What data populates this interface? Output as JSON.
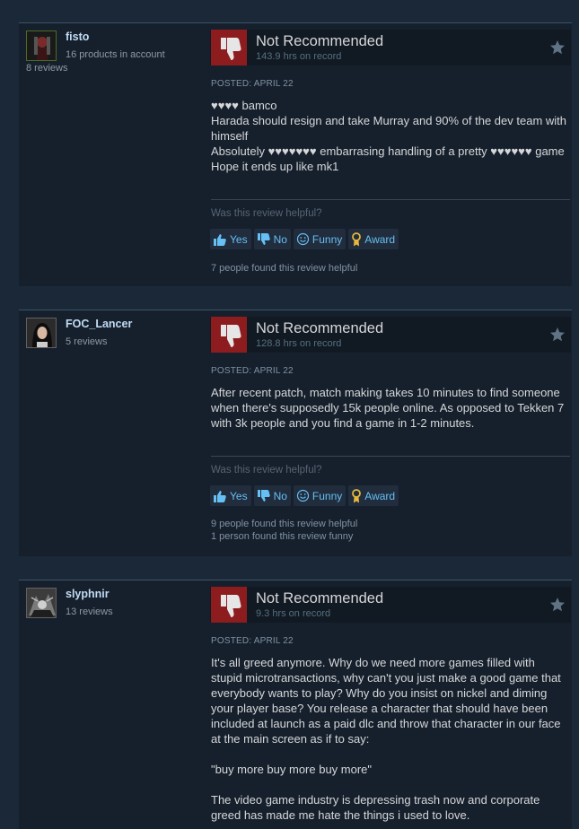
{
  "reviews": [
    {
      "username": "fisto",
      "products": "16 products in account",
      "review_count": "8 reviews",
      "verdict": "Not Recommended",
      "hours": "143.9 hrs on record",
      "posted": "POSTED: APRIL 22",
      "text": [
        "♥♥♥♥ bamco",
        "Harada should resign and take Murray and 90% of the dev team with himself",
        "Absolutely ♥♥♥♥♥♥♥ embarrasing handling of a pretty ♥♥♥♥♥♥ game",
        "Hope it ends up like mk1"
      ],
      "helpful_question": "Was this review helpful?",
      "buttons": {
        "yes": "Yes",
        "no": "No",
        "funny": "Funny",
        "award": "Award"
      },
      "found_helpful": "7 people found this review helpful",
      "found_funny": ""
    },
    {
      "username": "FOC_Lancer",
      "products": "",
      "review_count": "5 reviews",
      "verdict": "Not Recommended",
      "hours": "128.8 hrs on record",
      "posted": "POSTED: APRIL 22",
      "text": [
        "After recent patch, match making takes 10 minutes to find someone when there's supposedly 15k people online. As opposed to Tekken 7 with 3k people and you find a game in 1-2 minutes."
      ],
      "helpful_question": "Was this review helpful?",
      "buttons": {
        "yes": "Yes",
        "no": "No",
        "funny": "Funny",
        "award": "Award"
      },
      "found_helpful": "9 people found this review helpful",
      "found_funny": "1 person found this review funny"
    },
    {
      "username": "slyphnir",
      "products": "",
      "review_count": "13 reviews",
      "verdict": "Not Recommended",
      "hours": "9.3 hrs on record",
      "posted": "POSTED: APRIL 22",
      "text": [
        "It's all greed anymore. Why do we need more games filled with stupid microtransactions, why can't you just make a good game that everybody wants to play? Why do you insist on nickel and diming your player base? You release a character that should have been included at launch as a paid dlc and throw that character in our face at the main screen as if to say:",
        "",
        "\"buy more buy more buy more\"",
        "",
        "The video game industry is depressing trash now and corporate greed has made me hate the things i used to love."
      ]
    }
  ],
  "icons": {
    "thumbs_down": "thumbs-down-icon",
    "star": "star-icon",
    "yes": "thumbs-up-icon",
    "no": "thumbs-down-small-icon",
    "funny": "smiley-icon",
    "award": "award-icon"
  },
  "colors": {
    "background": "#1b2838",
    "card": "#16202d",
    "not_recommended": "#8d1c1f",
    "link": "#66c0f4"
  }
}
